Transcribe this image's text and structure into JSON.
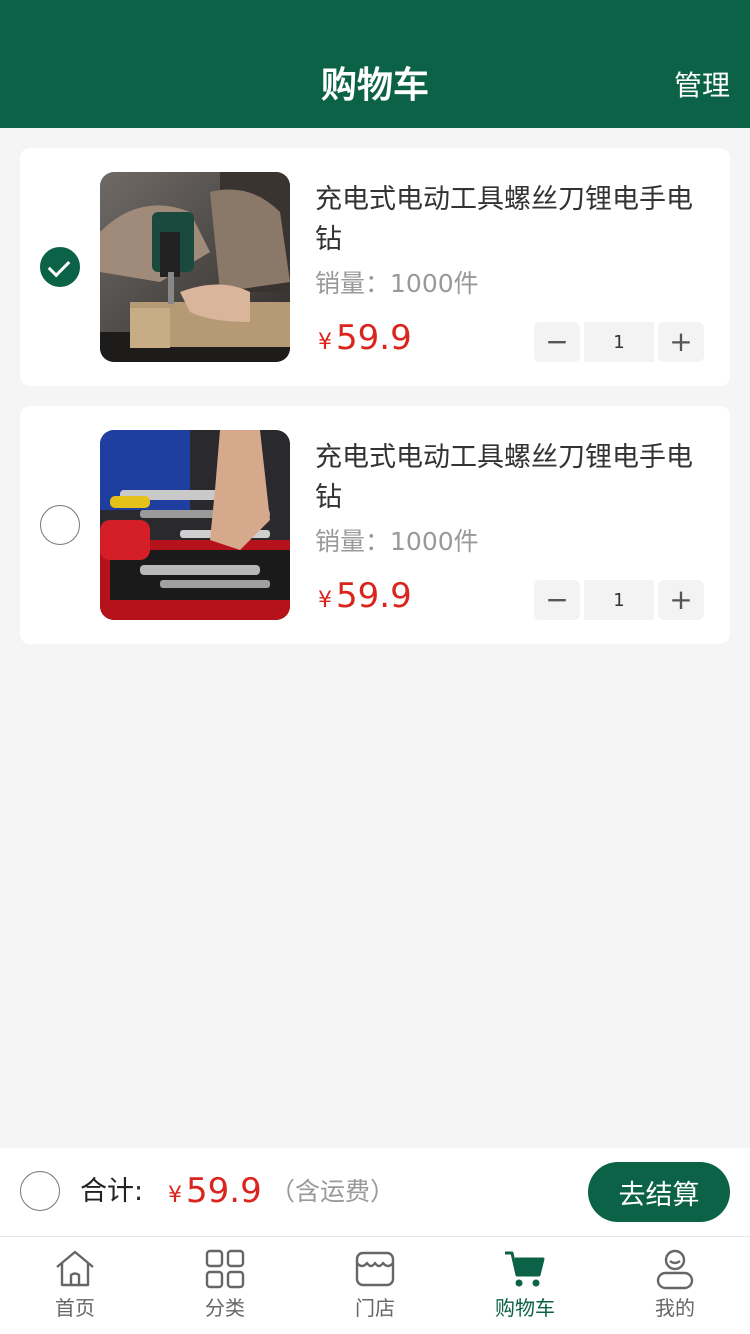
{
  "header": {
    "title": "购物车",
    "manage_label": "管理"
  },
  "cart": {
    "items": [
      {
        "name": "充电式电动工具螺丝刀锂电手电钻",
        "sales_label": "销量：",
        "sales_value": "1000件",
        "currency": "¥",
        "price": "59.9",
        "quantity": "1",
        "checked": true,
        "image": "drill-photo"
      },
      {
        "name": "充电式电动工具螺丝刀锂电手电钻",
        "sales_label": "销量：",
        "sales_value": "1000件",
        "currency": "¥",
        "price": "59.9",
        "quantity": "1",
        "checked": false,
        "image": "toolbox-photo"
      }
    ]
  },
  "stepper": {
    "minus": "−",
    "plus": "+"
  },
  "footer": {
    "total_label": "合计:",
    "currency": "¥",
    "total": "59.9",
    "note": "（含运费）",
    "checkout_label": "去结算"
  },
  "tabbar": {
    "items": [
      {
        "label": "首页",
        "icon": "home-icon",
        "active": false
      },
      {
        "label": "分类",
        "icon": "grid-icon",
        "active": false
      },
      {
        "label": "门店",
        "icon": "store-icon",
        "active": false
      },
      {
        "label": "购物车",
        "icon": "cart-icon",
        "active": true
      },
      {
        "label": "我的",
        "icon": "user-icon",
        "active": false
      }
    ]
  },
  "colors": {
    "brand": "#0b6246",
    "price": "#d9251d",
    "background": "#f5f5f5"
  }
}
